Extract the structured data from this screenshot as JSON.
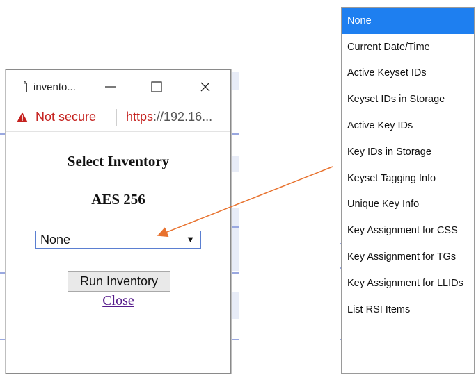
{
  "popup": {
    "tab_title": "invento...",
    "address": {
      "warning": "Not secure",
      "scheme": "https",
      "rest": "://192.16..."
    },
    "heading": "Select Inventory",
    "subheading": "AES 256",
    "select": {
      "value": "None"
    },
    "run_button": "Run Inventory",
    "close_link": "Close"
  },
  "dropdown": {
    "options": [
      "None",
      "Current Date/Time",
      "Active Keyset IDs",
      "Keyset IDs in Storage",
      "Active Key IDs",
      "Key IDs in Storage",
      "Keyset Tagging Info",
      "Unique Key Info",
      "Key Assignment for CSS",
      "Key Assignment for TGs",
      "Key Assignment for LLIDs",
      "List RSI Items"
    ],
    "selected_index": 0
  },
  "colors": {
    "selected_bg": "#1e7ff0",
    "annotation_arrow": "#e8722e",
    "not_secure": "#c5221f"
  }
}
